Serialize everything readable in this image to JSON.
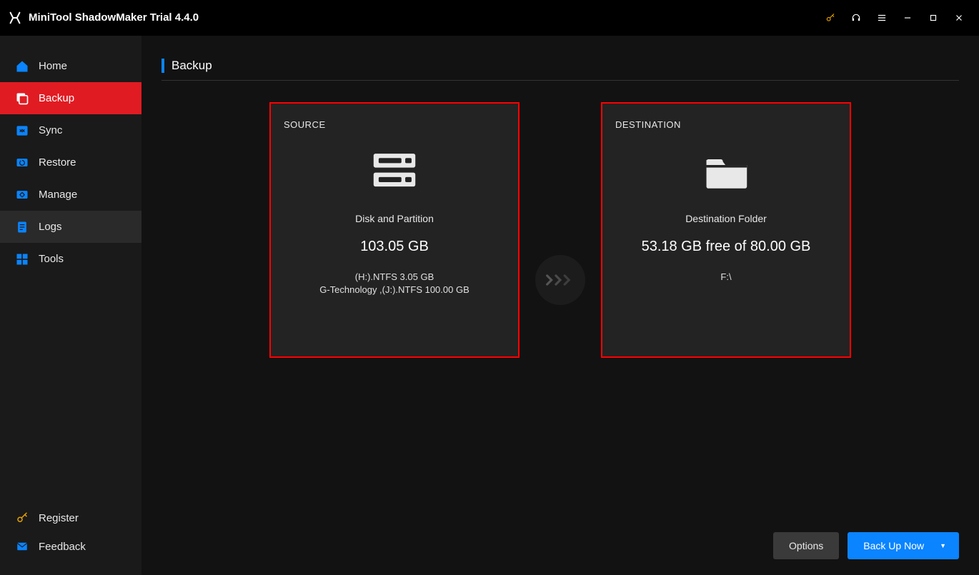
{
  "app": {
    "title": "MiniTool ShadowMaker Trial 4.4.0"
  },
  "sidebar": {
    "items": [
      {
        "label": "Home"
      },
      {
        "label": "Backup"
      },
      {
        "label": "Sync"
      },
      {
        "label": "Restore"
      },
      {
        "label": "Manage"
      },
      {
        "label": "Logs"
      },
      {
        "label": "Tools"
      }
    ],
    "bottom": {
      "register": "Register",
      "feedback": "Feedback"
    }
  },
  "page": {
    "title": "Backup"
  },
  "source": {
    "heading": "SOURCE",
    "type": "Disk and Partition",
    "total": "103.05 GB",
    "details": "(H:).NTFS 3.05 GB\nG-Technology ,(J:).NTFS 100.00 GB"
  },
  "destination": {
    "heading": "DESTINATION",
    "type": "Destination Folder",
    "space": "53.18 GB free of 80.00 GB",
    "path": "F:\\"
  },
  "footer": {
    "options": "Options",
    "backup_now": "Back Up Now"
  }
}
